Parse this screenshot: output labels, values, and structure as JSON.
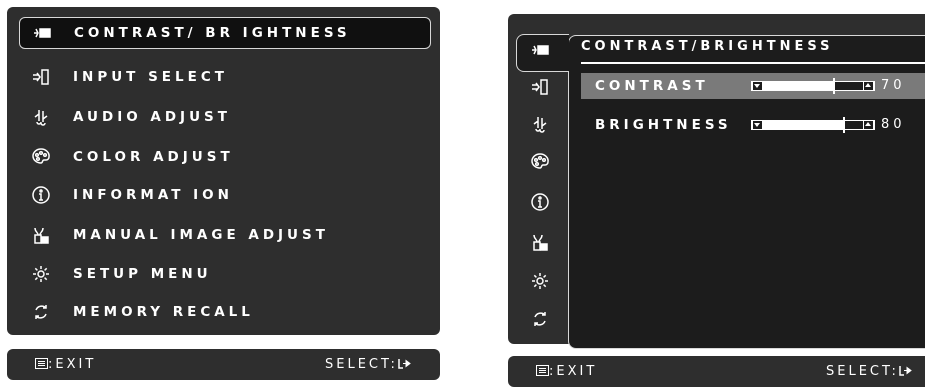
{
  "main_menu": {
    "items": [
      {
        "label": "CONTRAST/ BR IGHTNESS",
        "icon": "contrast-icon",
        "selected": true
      },
      {
        "label": "INPUT SELECT",
        "icon": "input-select-icon"
      },
      {
        "label": "AUDIO ADJUST",
        "icon": "audio-icon"
      },
      {
        "label": "COLOR ADJUST",
        "icon": "palette-icon"
      },
      {
        "label": "INFORMAT ION",
        "icon": "info-icon"
      },
      {
        "label": "MANUAL IMAGE ADJUST",
        "icon": "image-adjust-icon"
      },
      {
        "label": "SETUP MENU",
        "icon": "gear-icon"
      },
      {
        "label": "MEMORY RECALL",
        "icon": "memory-recall-icon"
      }
    ]
  },
  "left_footer": {
    "exit": ":EXIT",
    "select": "SELECT:"
  },
  "submenu": {
    "title": "CONTRAST/BRIGHTNESS",
    "rows": [
      {
        "label": "CONTRAST",
        "value": "70",
        "level": 0.7,
        "highlighted": true
      },
      {
        "label": "BRIGHTNESS",
        "value": "80",
        "level": 0.8
      }
    ]
  },
  "right_footer": {
    "exit": ":EXIT",
    "select": "SELECT:"
  },
  "colors": {
    "panel": "#2e2e2e",
    "highlight": "#7a7a7a",
    "text": "#ffffff"
  }
}
